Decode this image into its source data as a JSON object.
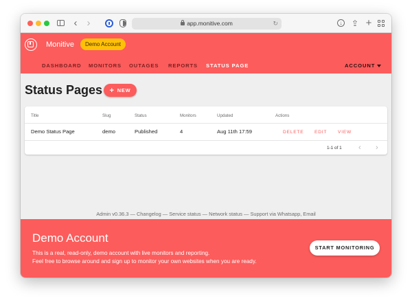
{
  "browser": {
    "url": "app.monitive.com",
    "icons": [
      "sidebar-icon",
      "back-icon",
      "forward-icon",
      "password-manager-icon",
      "shield-icon",
      "lock-icon",
      "reload-icon",
      "download-icon",
      "share-icon",
      "new-tab-icon",
      "tab-overview-icon"
    ]
  },
  "header": {
    "brand": "Monitive",
    "badge": "Demo Account",
    "nav": [
      "DASHBOARD",
      "MONITORS",
      "OUTAGES",
      "REPORTS",
      "STATUS PAGE"
    ],
    "active_nav": "STATUS PAGE",
    "account_label": "ACCOUNT",
    "accent": "#fc5c5c",
    "badge_color": "#ffc107"
  },
  "main": {
    "title": "Status Pages",
    "new_label": "NEW",
    "table": {
      "columns": [
        "Title",
        "Slug",
        "Status",
        "Monitors",
        "Updated",
        "Actions"
      ],
      "rows": [
        {
          "title": "Demo Status Page",
          "slug": "demo",
          "status": "Published",
          "monitors": "4",
          "updated": "Aug 11th 17:59",
          "actions": [
            "DELETE",
            "EDIT",
            "VIEW"
          ]
        }
      ],
      "pagination": "1-1 of 1"
    }
  },
  "footer": {
    "links_text": "Admin v0.36.3 — Changelog — Service status — Network status — Support via Whatsapp, Email"
  },
  "banner": {
    "title": "Demo Account",
    "line1": "This is a real, read-only, demo account with live monitors and reporting.",
    "line2": "Feel free to browse around and sign up to monitor your own websites when you are ready.",
    "button_label": "START MONITORING"
  }
}
